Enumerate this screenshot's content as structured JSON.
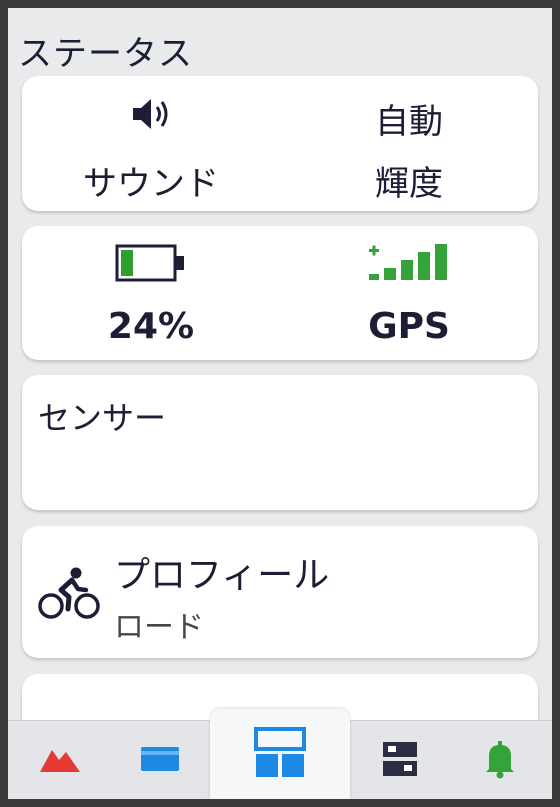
{
  "header": {
    "title": "ステータス"
  },
  "sound_card": {
    "sound_label": "サウンド",
    "brightness_value": "自動",
    "brightness_label": "輝度"
  },
  "status_card": {
    "battery_percent": "24%",
    "battery_fill_fraction": 0.24,
    "gps_label": "GPS",
    "gps_signal_bars": 4,
    "battery_color": "#2e9e2e",
    "gps_color": "#34a33a"
  },
  "sensor_card": {
    "label": "センサー"
  },
  "profile_card": {
    "label": "プロフィール",
    "value": "ロード"
  },
  "nav": {
    "items": [
      {
        "icon": "mountain-icon",
        "color": "#e53935"
      },
      {
        "icon": "card-icon",
        "color": "#1e88e5"
      },
      {
        "icon": "widget-grid-icon",
        "color": "#1e88e5",
        "active": true
      },
      {
        "icon": "device-list-icon",
        "color": "#2b2d42"
      },
      {
        "icon": "bell-icon",
        "color": "#34a33a"
      }
    ]
  }
}
